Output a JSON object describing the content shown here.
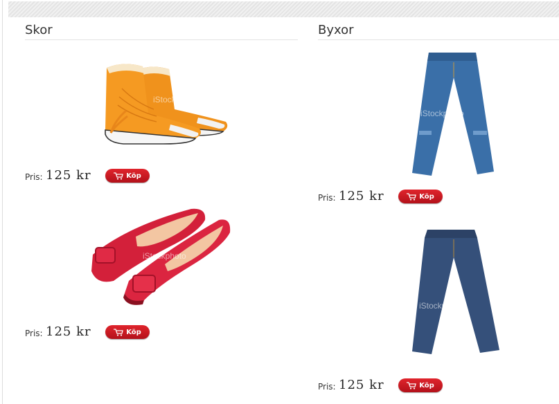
{
  "sections": {
    "skor": {
      "title": "Skor",
      "products": [
        {
          "image": "orange-sneakers",
          "watermark": "iStockphoto",
          "price_label": "Pris:",
          "price": "125 kr",
          "buy_label": "Köp"
        },
        {
          "image": "red-flats",
          "watermark": "iStockphoto",
          "price_label": "Pris:",
          "price": "125 kr",
          "buy_label": "Köp"
        }
      ]
    },
    "byxor": {
      "title": "Byxor",
      "products": [
        {
          "image": "light-blue-jeans",
          "watermark": "iStockphoto",
          "price_label": "Pris:",
          "price": "125 kr",
          "buy_label": "Köp"
        },
        {
          "image": "dark-blue-jeans",
          "watermark": "iStockphoto",
          "price_label": "Pris:",
          "price": "125 kr",
          "buy_label": "Köp"
        }
      ]
    }
  },
  "colors": {
    "buy_button": "#c8161e",
    "heading_rule": "#e4e4e4"
  }
}
